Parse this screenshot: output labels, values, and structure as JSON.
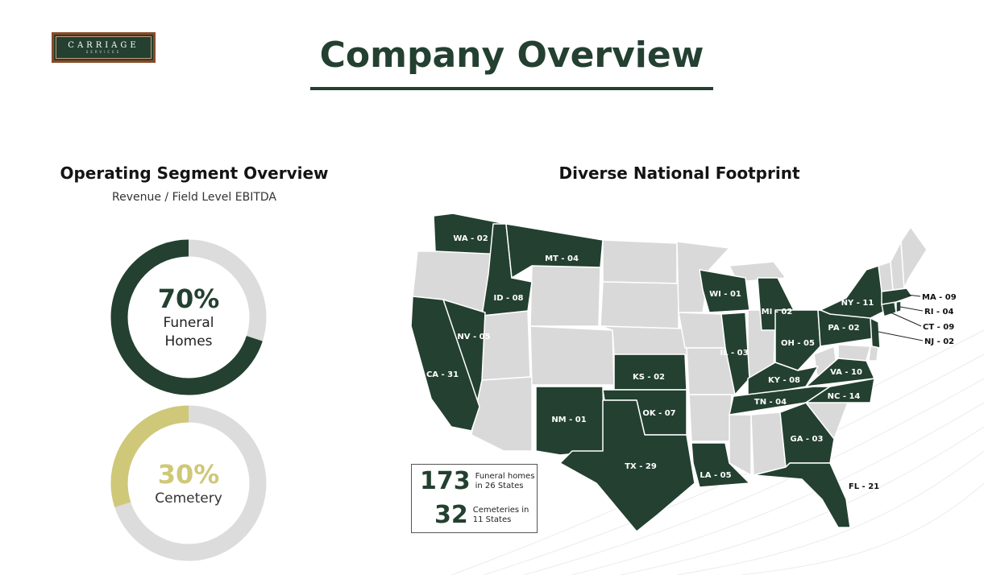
{
  "logo": {
    "main": "CARRIAGE",
    "sub": "SERVICES"
  },
  "title": "Company Overview",
  "segment": {
    "title": "Operating Segment Overview",
    "subtitle": "Revenue / Field Level EBITDA",
    "funeral": {
      "pct": "70%",
      "label_line1": "Funeral",
      "label_line2": "Homes",
      "value": 70,
      "color": "#234030"
    },
    "cemetery": {
      "pct": "30%",
      "label": "Cemetery",
      "value": 30,
      "color": "#cfc878"
    },
    "track_color": "#dcdcdc"
  },
  "map": {
    "title": "Diverse National Footprint",
    "active_color": "#234030",
    "inactive_color": "#d9d9d9",
    "labels": {
      "wa": "WA - 02",
      "mt": "MT - 04",
      "id": "ID - 08",
      "nv": "NV - 05",
      "ca": "CA - 31",
      "nm": "NM - 01",
      "tx": "TX - 29",
      "ok": "OK - 07",
      "ks": "KS - 02",
      "la": "LA - 05",
      "wi": "WI - 01",
      "il": "IL - 03",
      "mi": "MI - 02",
      "oh": "OH - 05",
      "ky": "KY - 08",
      "tn": "TN - 04",
      "ga": "GA - 03",
      "fl": "FL - 21",
      "nc": "NC - 14",
      "va": "VA - 10",
      "pa": "PA - 02",
      "ny": "NY - 11",
      "ma": "MA - 09",
      "ri": "RI - 04",
      "ct": "CT - 09",
      "nj": "NJ - 02"
    }
  },
  "stats": {
    "funeral_count": "173",
    "funeral_desc1": "Funeral homes",
    "funeral_desc2": "in 26 States",
    "cemetery_count": "32",
    "cemetery_desc1": "Cemeteries in",
    "cemetery_desc2": "11 States"
  }
}
